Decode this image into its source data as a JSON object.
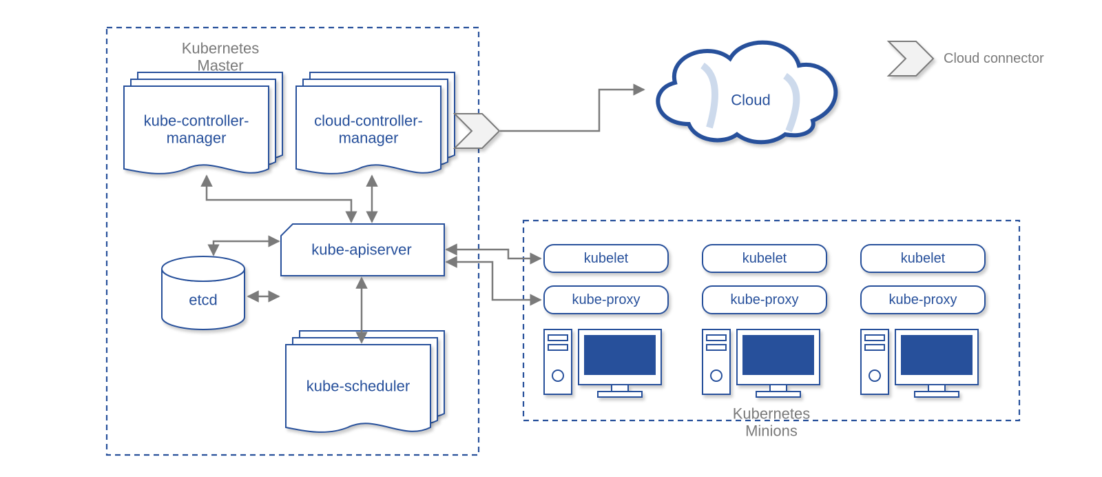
{
  "master": {
    "title1": "Kubernetes",
    "title2": "Master",
    "kcm1": "kube-controller-",
    "kcm2": "manager",
    "ccm1": "cloud-controller-",
    "ccm2": "manager",
    "api": "kube-apiserver",
    "etcd": "etcd",
    "sched": "kube-scheduler"
  },
  "cloud": {
    "label": "Cloud"
  },
  "legend": {
    "label": "Cloud connector"
  },
  "minions": {
    "title1": "Kubernetes",
    "title2": "Minions",
    "nodes": [
      {
        "kubelet": "kubelet",
        "proxy": "kube-proxy"
      },
      {
        "kubelet": "kubelet",
        "proxy": "kube-proxy"
      },
      {
        "kubelet": "kubelet",
        "proxy": "kube-proxy"
      }
    ]
  },
  "colors": {
    "blue": "#27509b",
    "grey": "#7a7a7a"
  }
}
